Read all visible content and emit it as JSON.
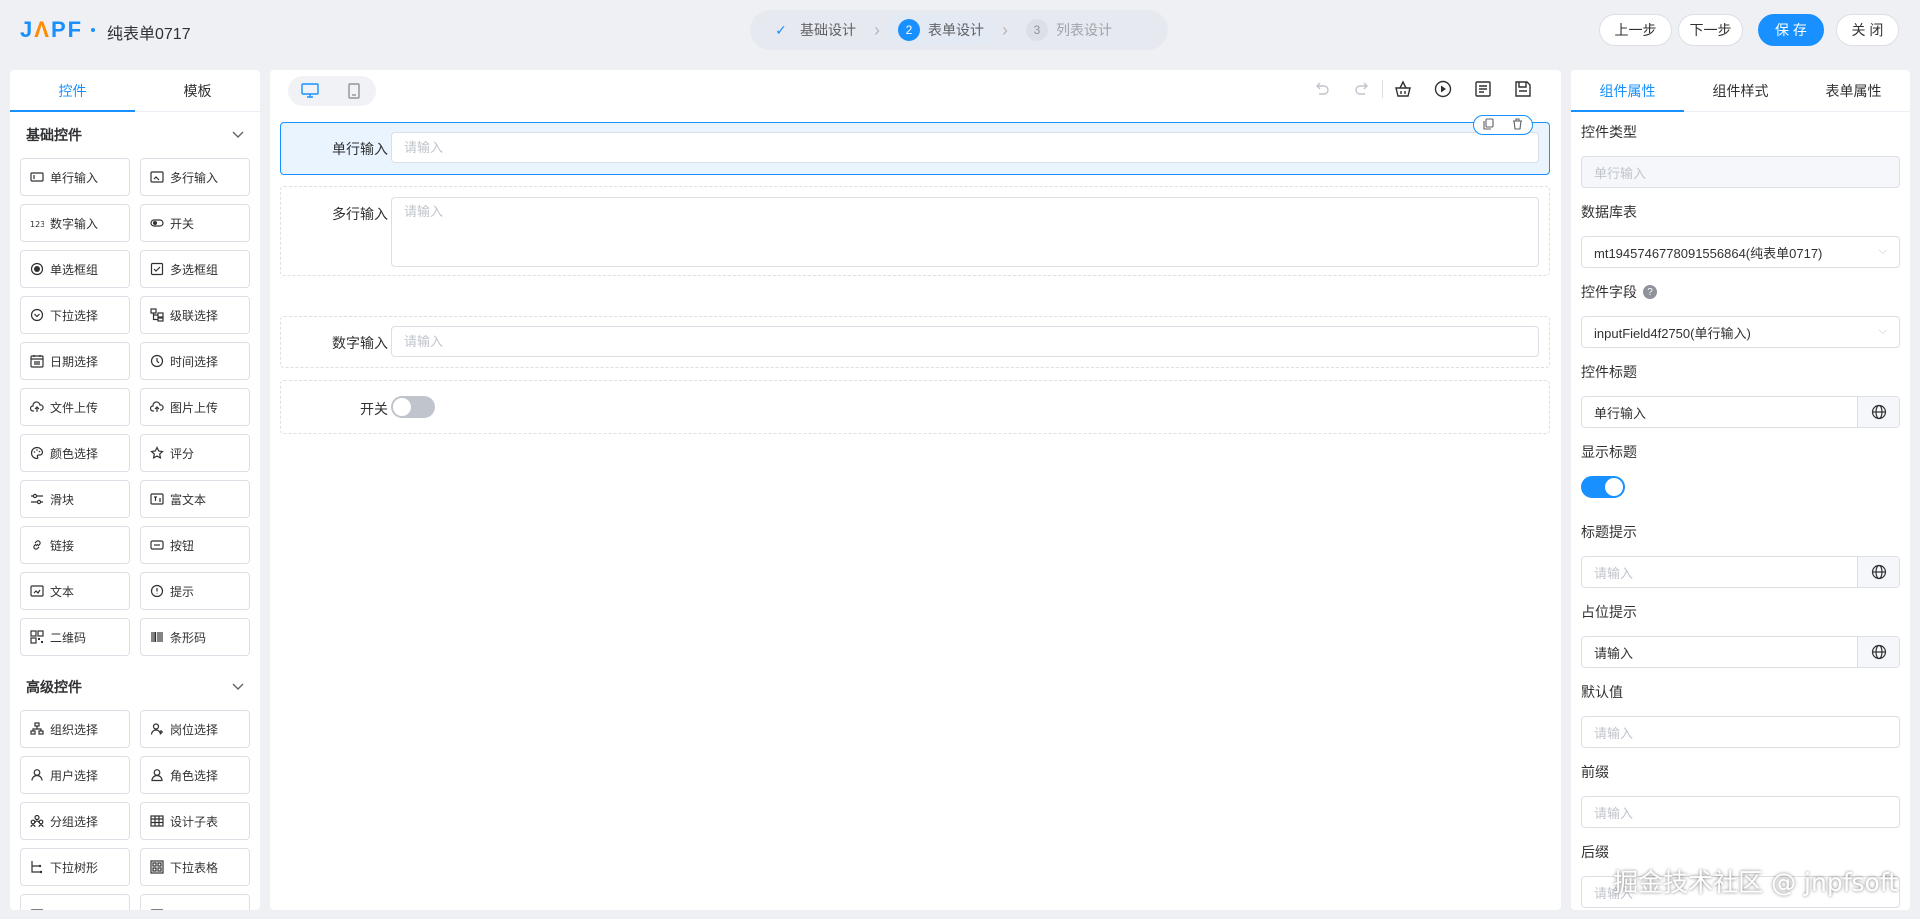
{
  "header": {
    "logo": "JNPF",
    "title": "纯表单0717",
    "steps": [
      {
        "num": "✓",
        "label": "基础设计",
        "state": "done"
      },
      {
        "num": "2",
        "label": "表单设计",
        "state": "active"
      },
      {
        "num": "3",
        "label": "列表设计",
        "state": "todo"
      }
    ],
    "prev_label": "上一步",
    "next_label": "下一步",
    "save_label": "保 存",
    "close_label": "关 闭"
  },
  "left": {
    "tabs": [
      "控件",
      "模板"
    ],
    "basic_title": "基础控件",
    "advanced_title": "高级控件",
    "basic": [
      {
        "label": "单行输入",
        "icon": "input-icon"
      },
      {
        "label": "多行输入",
        "icon": "textarea-icon"
      },
      {
        "label": "数字输入",
        "icon": "number-icon"
      },
      {
        "label": "开关",
        "icon": "switch-icon"
      },
      {
        "label": "单选框组",
        "icon": "radio-icon"
      },
      {
        "label": "多选框组",
        "icon": "checkbox-icon"
      },
      {
        "label": "下拉选择",
        "icon": "select-icon"
      },
      {
        "label": "级联选择",
        "icon": "cascader-icon"
      },
      {
        "label": "日期选择",
        "icon": "calendar-icon"
      },
      {
        "label": "时间选择",
        "icon": "clock-icon"
      },
      {
        "label": "文件上传",
        "icon": "upload-icon"
      },
      {
        "label": "图片上传",
        "icon": "image-upload-icon"
      },
      {
        "label": "颜色选择",
        "icon": "palette-icon"
      },
      {
        "label": "评分",
        "icon": "star-icon"
      },
      {
        "label": "滑块",
        "icon": "slider-icon"
      },
      {
        "label": "富文本",
        "icon": "richtext-icon"
      },
      {
        "label": "链接",
        "icon": "link-icon"
      },
      {
        "label": "按钮",
        "icon": "button-icon"
      },
      {
        "label": "文本",
        "icon": "text-icon"
      },
      {
        "label": "提示",
        "icon": "alert-icon"
      },
      {
        "label": "二维码",
        "icon": "qrcode-icon"
      },
      {
        "label": "条形码",
        "icon": "barcode-icon"
      }
    ],
    "advanced": [
      {
        "label": "组织选择",
        "icon": "org-icon"
      },
      {
        "label": "岗位选择",
        "icon": "position-icon"
      },
      {
        "label": "用户选择",
        "icon": "user-icon"
      },
      {
        "label": "角色选择",
        "icon": "role-icon"
      },
      {
        "label": "分组选择",
        "icon": "group-icon"
      },
      {
        "label": "设计子表",
        "icon": "table-icon"
      },
      {
        "label": "下拉树形",
        "icon": "tree-icon"
      },
      {
        "label": "下拉表格",
        "icon": "grid-icon"
      },
      {
        "label": "",
        "icon": "more-icon"
      },
      {
        "label": "",
        "icon": "more-icon"
      }
    ]
  },
  "canvas": {
    "fields": [
      {
        "label": "单行输入",
        "placeholder": "请输入"
      },
      {
        "label": "多行输入",
        "placeholder": "请输入"
      },
      {
        "label": "数字输入",
        "placeholder": "请输入"
      },
      {
        "label": "开关"
      }
    ]
  },
  "right": {
    "tabs": [
      "组件属性",
      "组件样式",
      "表单属性"
    ],
    "props": [
      {
        "label": "控件类型",
        "value": "单行输入"
      },
      {
        "label": "数据库表",
        "value": "mt1945746778091556864(纯表单0717)"
      },
      {
        "label": "控件字段",
        "value": "inputField4f2750(单行输入)"
      },
      {
        "label": "控件标题",
        "value": "单行输入"
      },
      {
        "label": "显示标题"
      },
      {
        "label": "标题提示",
        "value": "请输入"
      },
      {
        "label": "占位提示",
        "value": "请输入"
      },
      {
        "label": "默认值",
        "value": "请输入"
      },
      {
        "label": "前缀",
        "value": "请输入"
      },
      {
        "label": "后缀",
        "value": "请输入"
      }
    ]
  },
  "watermark": "掘金技术社区 @ jnpfsoft",
  "colors": {
    "primary": "#1890ff",
    "logo_accent": "#ff8a00"
  }
}
